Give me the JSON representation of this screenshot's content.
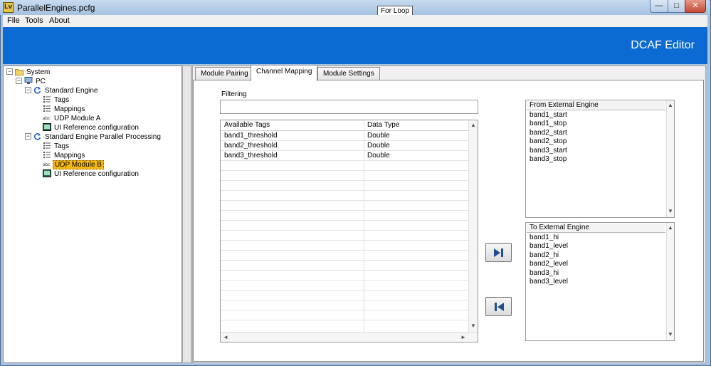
{
  "window": {
    "title": "ParallelEngines.pcfg",
    "app_icon_glyph": "Lv",
    "tooltip": "For Loop",
    "controls": {
      "minimize": "—",
      "maximize": "□",
      "close": "✕"
    }
  },
  "menu": {
    "file": "File",
    "tools": "Tools",
    "about": "About"
  },
  "banner": {
    "title": "DCAF Editor",
    "color": "#0b6bd3"
  },
  "tree": {
    "system": "System",
    "pc": "PC",
    "standard_engine": "Standard Engine",
    "se_tags": "Tags",
    "se_mappings": "Mappings",
    "se_udp_a": "UDP Module A",
    "se_ui_ref": "UI Reference configuration",
    "parallel_engine": "Standard Engine Parallel Processing",
    "pe_tags": "Tags",
    "pe_mappings": "Mappings",
    "pe_udp_b": "UDP Module B",
    "pe_ui_ref": "UI Reference configuration",
    "expander_glyph": "−",
    "selected_color": "#f5b712"
  },
  "tabs": {
    "module_pairing": "Module Pairing",
    "channel_mapping": "Channel Mapping",
    "module_settings": "Module Settings"
  },
  "filter": {
    "label": "Filtering",
    "value": ""
  },
  "tags_table": {
    "headers": {
      "tag": "Available Tags",
      "type": "Data Type"
    },
    "rows": [
      {
        "tag": "band1_threshold",
        "type": "Double"
      },
      {
        "tag": "band2_threshold",
        "type": "Double"
      },
      {
        "tag": "band3_threshold",
        "type": "Double"
      }
    ]
  },
  "from_external": {
    "header": "From External Engine",
    "items": [
      "band1_start",
      "band1_stop",
      "band2_start",
      "band2_stop",
      "band3_start",
      "band3_stop"
    ]
  },
  "to_external": {
    "header": "To External Engine",
    "items": [
      "band1_hi",
      "band1_level",
      "band2_hi",
      "band2_level",
      "band3_hi",
      "band3_level"
    ]
  },
  "scroll": {
    "up": "▲",
    "down": "▼",
    "left": "◄",
    "right": "►"
  }
}
